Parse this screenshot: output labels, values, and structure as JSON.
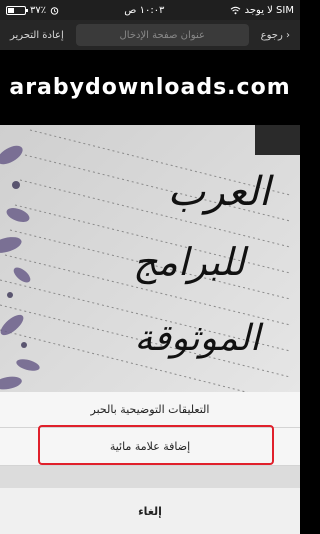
{
  "status_bar": {
    "carrier": "لا يوجد SIM",
    "time": "١٠:٠٣ ص",
    "battery": "٣٧٪",
    "battery_level": 0.37,
    "icons": [
      "wifi-icon",
      "alarm-icon",
      "battery-icon"
    ]
  },
  "toolbar": {
    "back_label": "رجوع",
    "address_placeholder": "عنوان صفحة الإدخال",
    "redo_label": "إعادة التحرير"
  },
  "banner": {
    "watermark_text": "arabydownloads.com"
  },
  "image": {
    "handwriting_lines": [
      "العرب",
      "للبرامج",
      "الموثوقة"
    ]
  },
  "action_sheet": {
    "items": [
      {
        "label": "التعليقات التوضيحية بالحبر"
      },
      {
        "label": "إضافة علامة مائية"
      }
    ],
    "cancel_label": "إلغاء",
    "highlight_color": "#e0202b"
  }
}
